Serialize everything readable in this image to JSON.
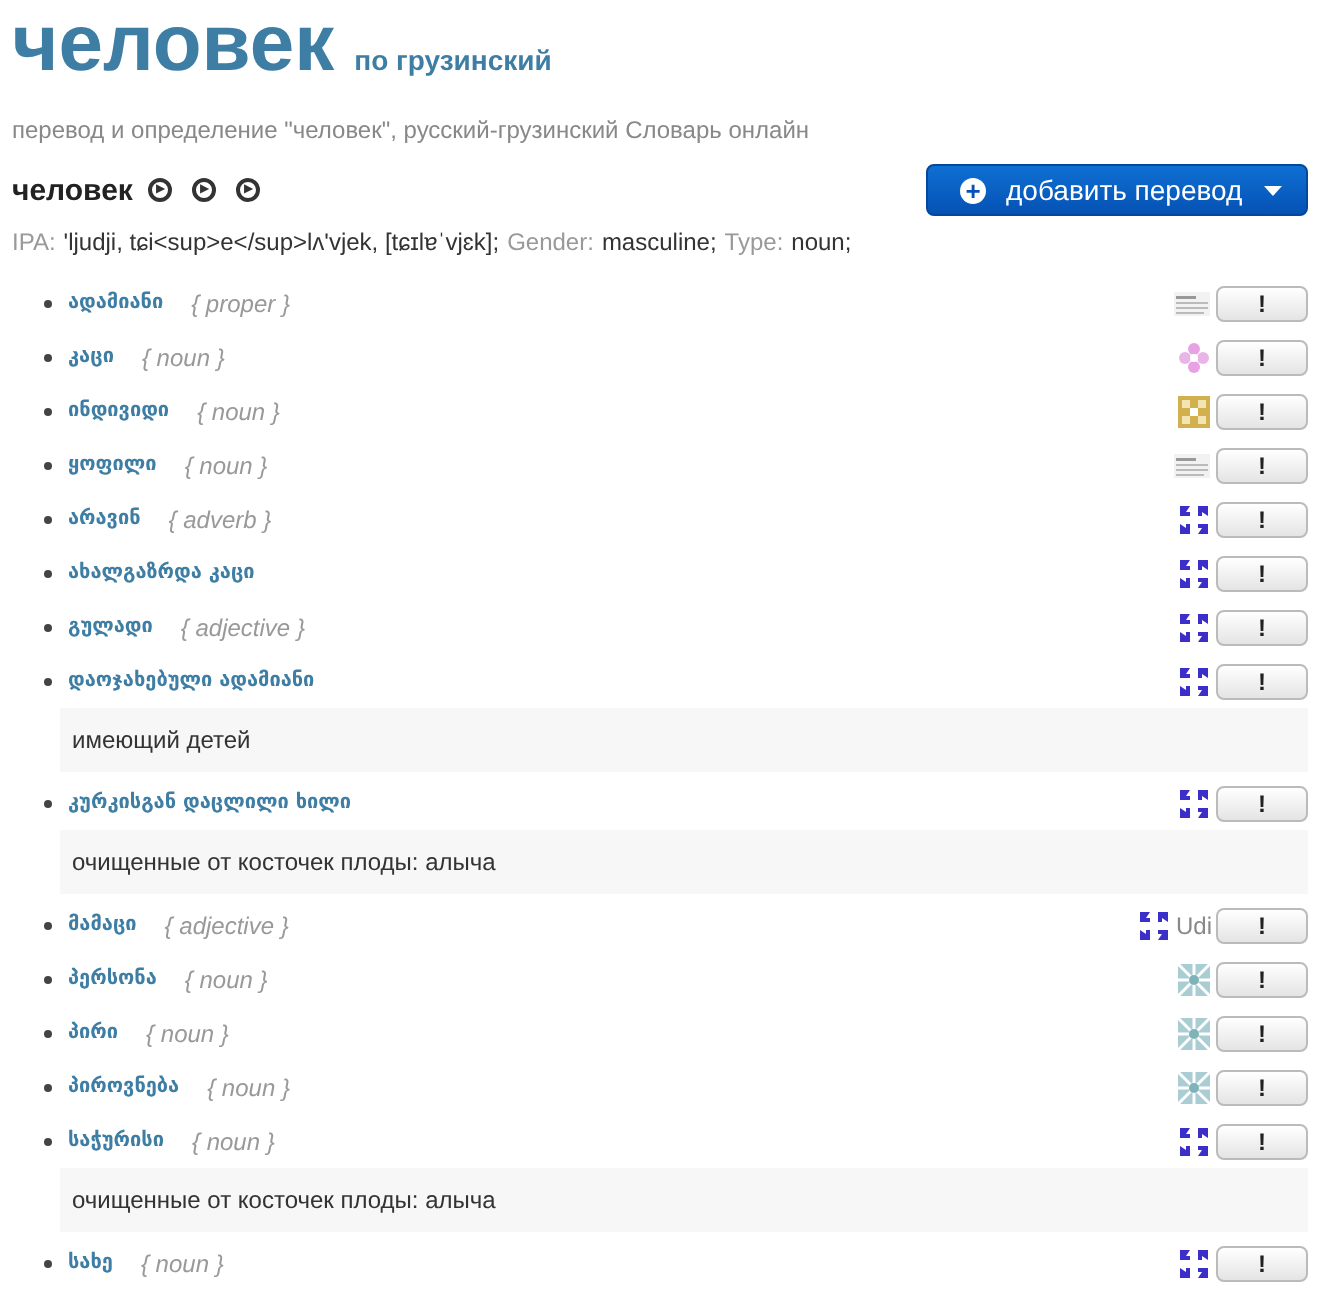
{
  "header": {
    "title": "человек",
    "subtitle": "по грузинский",
    "description": "перевод и определение \"человек\", русский-грузинский Словарь  онлайн"
  },
  "word": {
    "text": "человек",
    "audio": [
      "▶",
      "▶",
      "▶"
    ]
  },
  "add_button": {
    "label": "добавить перевод",
    "icon": "+"
  },
  "info": [
    {
      "label": "IPA:",
      "value": "'ljudji, tɕi<sup>e</sup>lʌ'vjek, [tɕɪlɐˈvjɛk];"
    },
    {
      "label": "Gender:",
      "value": "masculine;"
    },
    {
      "label": "Type:",
      "value": "noun;"
    }
  ],
  "translations": [
    {
      "term": "ადამიანი",
      "pos": "{ proper }",
      "kind": "doc"
    },
    {
      "term": "კაცი",
      "pos": "{ noun }",
      "kind": "flower"
    },
    {
      "term": "ინდივიდი",
      "pos": "{ noun }",
      "kind": "pattern"
    },
    {
      "term": "ყოფილი",
      "pos": "{ noun }",
      "kind": "doc"
    },
    {
      "term": "არავინ",
      "pos": "{ adverb }",
      "kind": "glyph"
    },
    {
      "term": "ახალგაზრდა კაცი",
      "kind": "glyph"
    },
    {
      "term": "გულადი",
      "pos": "{ adjective }",
      "kind": "glyph"
    },
    {
      "term": "დაოჯახებული ადამიანი",
      "kind": "glyph",
      "definition": "имеющий детей"
    },
    {
      "term": "კურკისგან დაცლილი ხილი",
      "kind": "glyph",
      "definition": "очищенные от косточек плоды: алыча"
    },
    {
      "term": "მამაცი",
      "pos": "{ adjective }",
      "kind": "glyph",
      "source_label": "Udi"
    },
    {
      "term": "პერსონა",
      "pos": "{ noun }",
      "kind": "tile"
    },
    {
      "term": "პირი",
      "pos": "{ noun }",
      "kind": "tile"
    },
    {
      "term": "პიროვნება",
      "pos": "{ noun }",
      "kind": "tile"
    },
    {
      "term": "საჭურისი",
      "pos": "{ noun }",
      "kind": "glyph",
      "definition": "очищенные от косточек плоды: алыча"
    },
    {
      "term": "სახე",
      "pos": "{ noun }",
      "kind": "glyph"
    }
  ],
  "report_label": "!"
}
